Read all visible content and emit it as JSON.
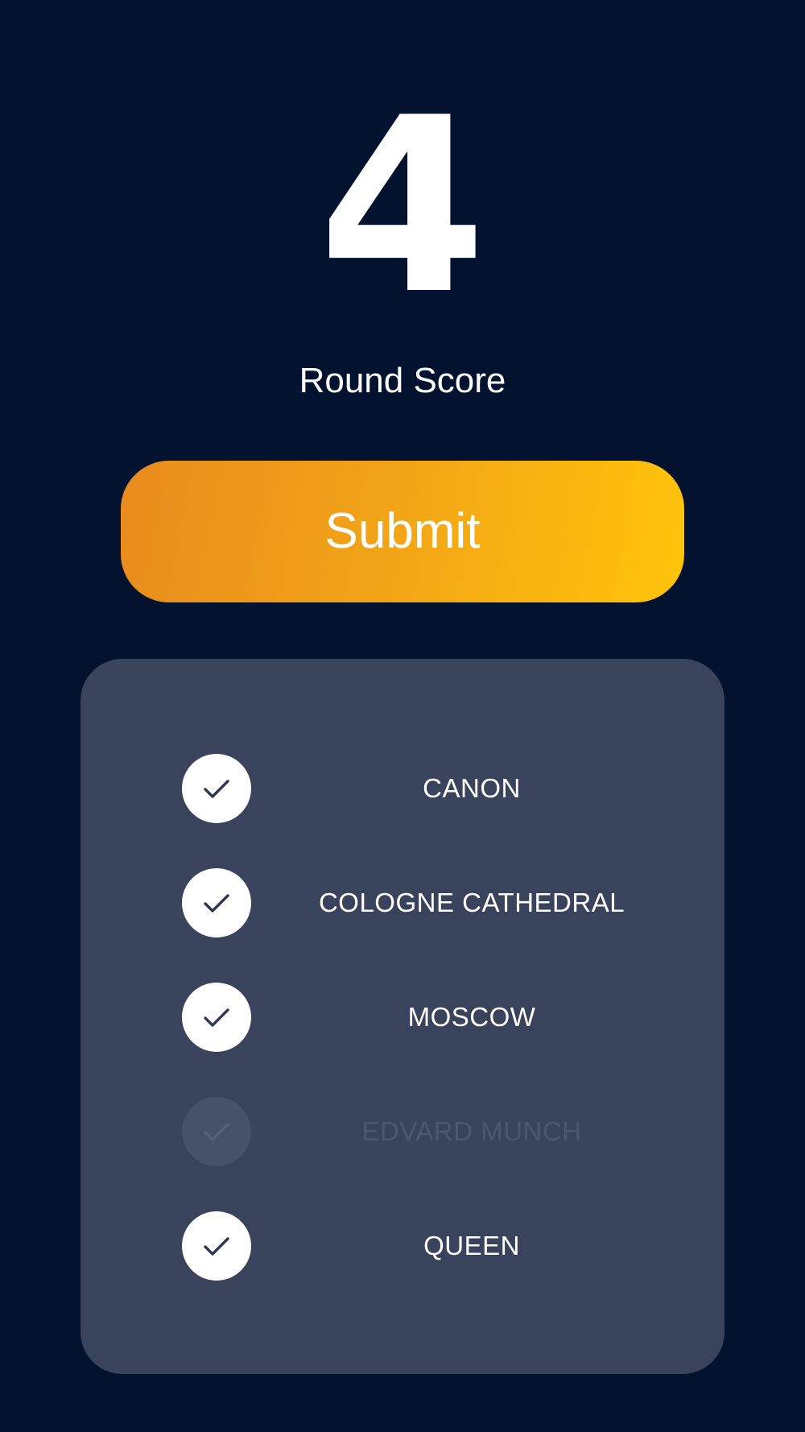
{
  "score": {
    "value": "4",
    "label": "Round Score"
  },
  "submit": {
    "label": "Submit"
  },
  "answers": [
    {
      "label": "CANON",
      "checked": true,
      "icon": "check-icon"
    },
    {
      "label": "COLOGNE CATHEDRAL",
      "checked": true,
      "icon": "check-icon"
    },
    {
      "label": "MOSCOW",
      "checked": true,
      "icon": "check-icon"
    },
    {
      "label": "EDVARD MUNCH",
      "checked": false,
      "icon": "check-icon"
    },
    {
      "label": "QUEEN",
      "checked": true,
      "icon": "check-icon"
    }
  ],
  "colors": {
    "background": "#03132f",
    "panel": "#39435b",
    "button_start": "#e88b1d",
    "button_end": "#ffc40a",
    "check_mark": "#2e3850"
  }
}
